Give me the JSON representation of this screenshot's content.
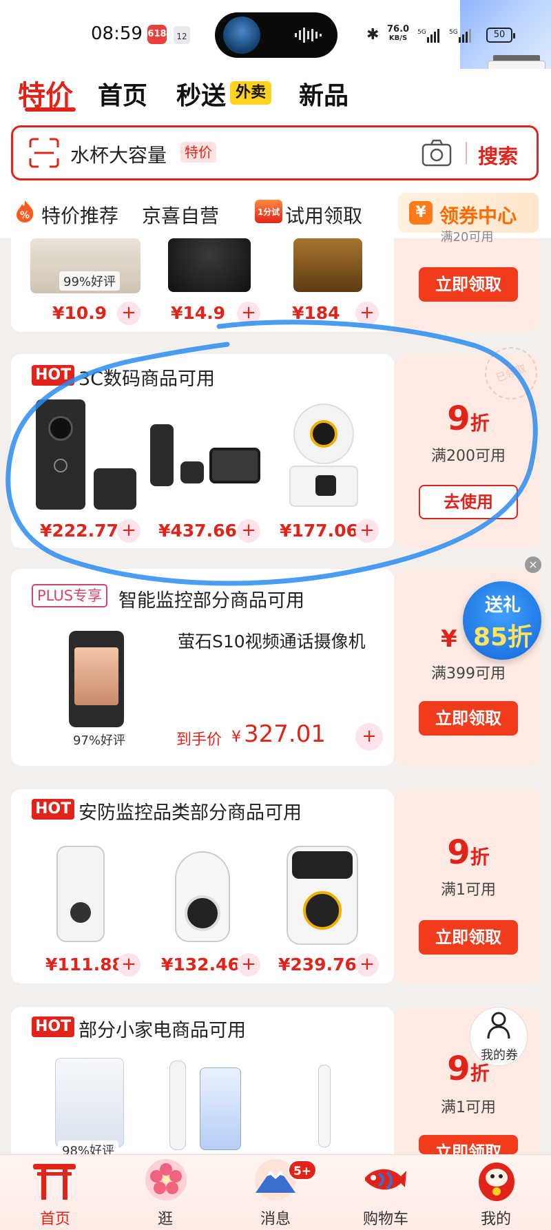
{
  "status_bar": {
    "time": "08:59",
    "app_icon_text": "618",
    "calendar_text": "12",
    "network_speed_value": "76.0",
    "network_speed_unit": "KB/S",
    "battery": "50"
  },
  "tabs": [
    {
      "label": "特价",
      "active": true
    },
    {
      "label": "首页",
      "active": false
    },
    {
      "label": "秒送",
      "active": false
    },
    {
      "label": "新品",
      "active": false
    }
  ],
  "waimai_badge": "外卖",
  "search": {
    "query": "水杯大容量",
    "tag": "特价",
    "button": "搜索"
  },
  "nav": {
    "items": [
      "特价推荐",
      "京喜自营",
      "试用领取"
    ],
    "trial_icon_text": "1分试",
    "coupon_center": "领券中心",
    "coupon_center_icon": "¥"
  },
  "cards": [
    {
      "prices": [
        "¥10.9",
        "¥14.9",
        "¥184"
      ],
      "rating": "99%好评",
      "condition": "满20可用",
      "button": "立即领取"
    },
    {
      "tag": "HOT",
      "title": "3C数码商品可用",
      "prices": [
        "¥222.77",
        "¥437.66",
        "¥177.06"
      ],
      "discount_num": "9",
      "discount_unit": "折",
      "condition": "满200可用",
      "button": "去使用",
      "stamp": "已领取"
    },
    {
      "tag": "PLUS专享",
      "title": "智能监控部分商品可用",
      "product_name": "萤石S10视频通话摄像机",
      "rating": "97%好评",
      "price_label": "到手价",
      "price_symbol": "¥",
      "price": "327.01",
      "discount_partial": "¥",
      "condition": "满399可用",
      "button": "立即领取"
    },
    {
      "tag": "HOT",
      "title": "安防监控品类部分商品可用",
      "prices": [
        "¥111.88",
        "¥132.46",
        "¥239.76"
      ],
      "discount_num": "9",
      "discount_unit": "折",
      "condition": "满1可用",
      "button": "立即领取"
    },
    {
      "tag": "HOT",
      "title": "部分小家电商品可用",
      "rating": "98%好评",
      "discount_num": "9",
      "discount_unit": "折",
      "condition": "满1可用",
      "button": "立即领取"
    }
  ],
  "gift_float": {
    "line1": "送礼",
    "line2": "85折",
    "close": "×"
  },
  "my_coupon": "我的券",
  "bottom_nav": [
    {
      "label": "首页",
      "active": true
    },
    {
      "label": "逛",
      "active": false
    },
    {
      "label": "消息",
      "active": false,
      "badge": "5+"
    },
    {
      "label": "购物车",
      "active": false
    },
    {
      "label": "我的",
      "active": false
    }
  ],
  "colors": {
    "brand_red": "#e2231a",
    "claim_orange": "#f03c1d",
    "coupon_bg": "#fdebe3",
    "marker_blue": "#2a8cf0"
  }
}
